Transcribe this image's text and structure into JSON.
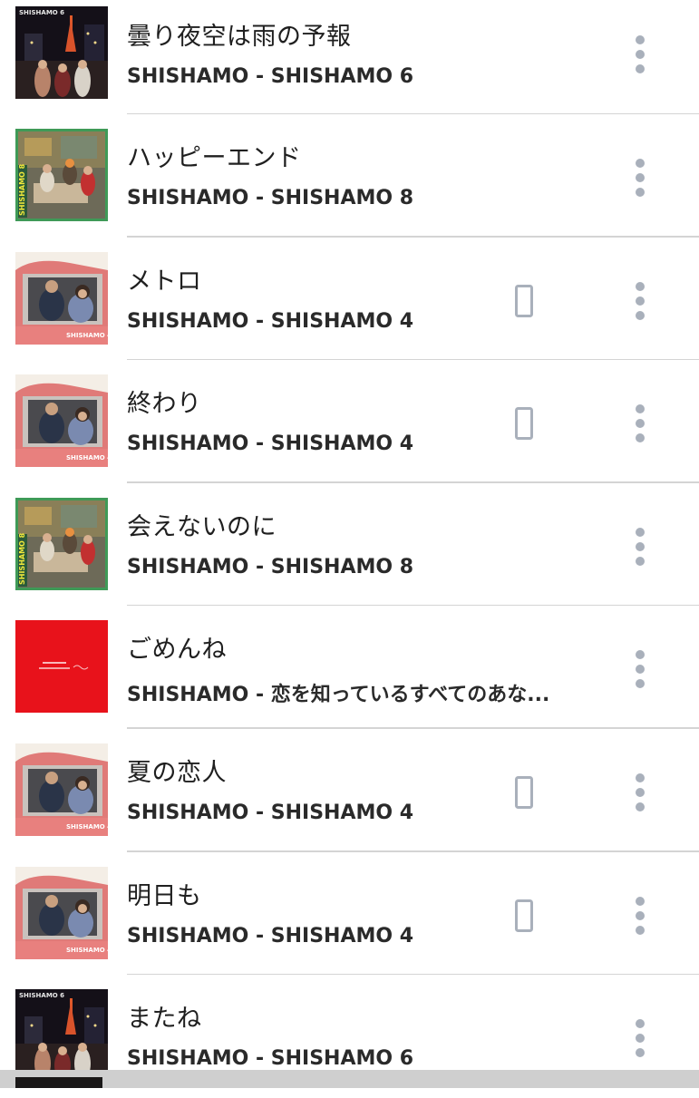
{
  "songs": [
    {
      "title": "曇り夜空は雨の予報",
      "subtitle": "SHISHAMO - SHISHAMO 6",
      "album": "shishamo6",
      "downloaded": false
    },
    {
      "title": "ハッピーエンド",
      "subtitle": "SHISHAMO - SHISHAMO 8",
      "album": "shishamo8",
      "downloaded": false
    },
    {
      "title": "メトロ",
      "subtitle": "SHISHAMO - SHISHAMO 4",
      "album": "shishamo4",
      "downloaded": true
    },
    {
      "title": "終わり",
      "subtitle": "SHISHAMO - SHISHAMO 4",
      "album": "shishamo4",
      "downloaded": true
    },
    {
      "title": "会えないのに",
      "subtitle": "SHISHAMO - SHISHAMO 8",
      "album": "shishamo8",
      "downloaded": false
    },
    {
      "title": "ごめんね",
      "subtitle": "SHISHAMO - 恋を知っているすべてのあな...",
      "album": "koi",
      "downloaded": false
    },
    {
      "title": "夏の恋人",
      "subtitle": "SHISHAMO - SHISHAMO 4",
      "album": "shishamo4",
      "downloaded": true
    },
    {
      "title": "明日も",
      "subtitle": "SHISHAMO - SHISHAMO 4",
      "album": "shishamo4",
      "downloaded": true
    },
    {
      "title": "またね",
      "subtitle": "SHISHAMO - SHISHAMO 6",
      "album": "shishamo6",
      "downloaded": false
    }
  ],
  "icons": {
    "downloaded": "smartphone-icon",
    "more": "more-vert-icon"
  },
  "colors": {
    "icon_gray": "#a9b0bb",
    "divider": "#d4d4d4",
    "koi_cover_red": "#e8121b",
    "shishamo8_frame": "#3f9a57"
  },
  "album_art": {
    "shishamo6": {
      "label": "SHISHAMO 6"
    },
    "shishamo8": {
      "label": "SHISHAMO 8"
    },
    "shishamo4": {
      "label": "SHISHAMO 4"
    },
    "koi": {
      "label": ""
    }
  }
}
